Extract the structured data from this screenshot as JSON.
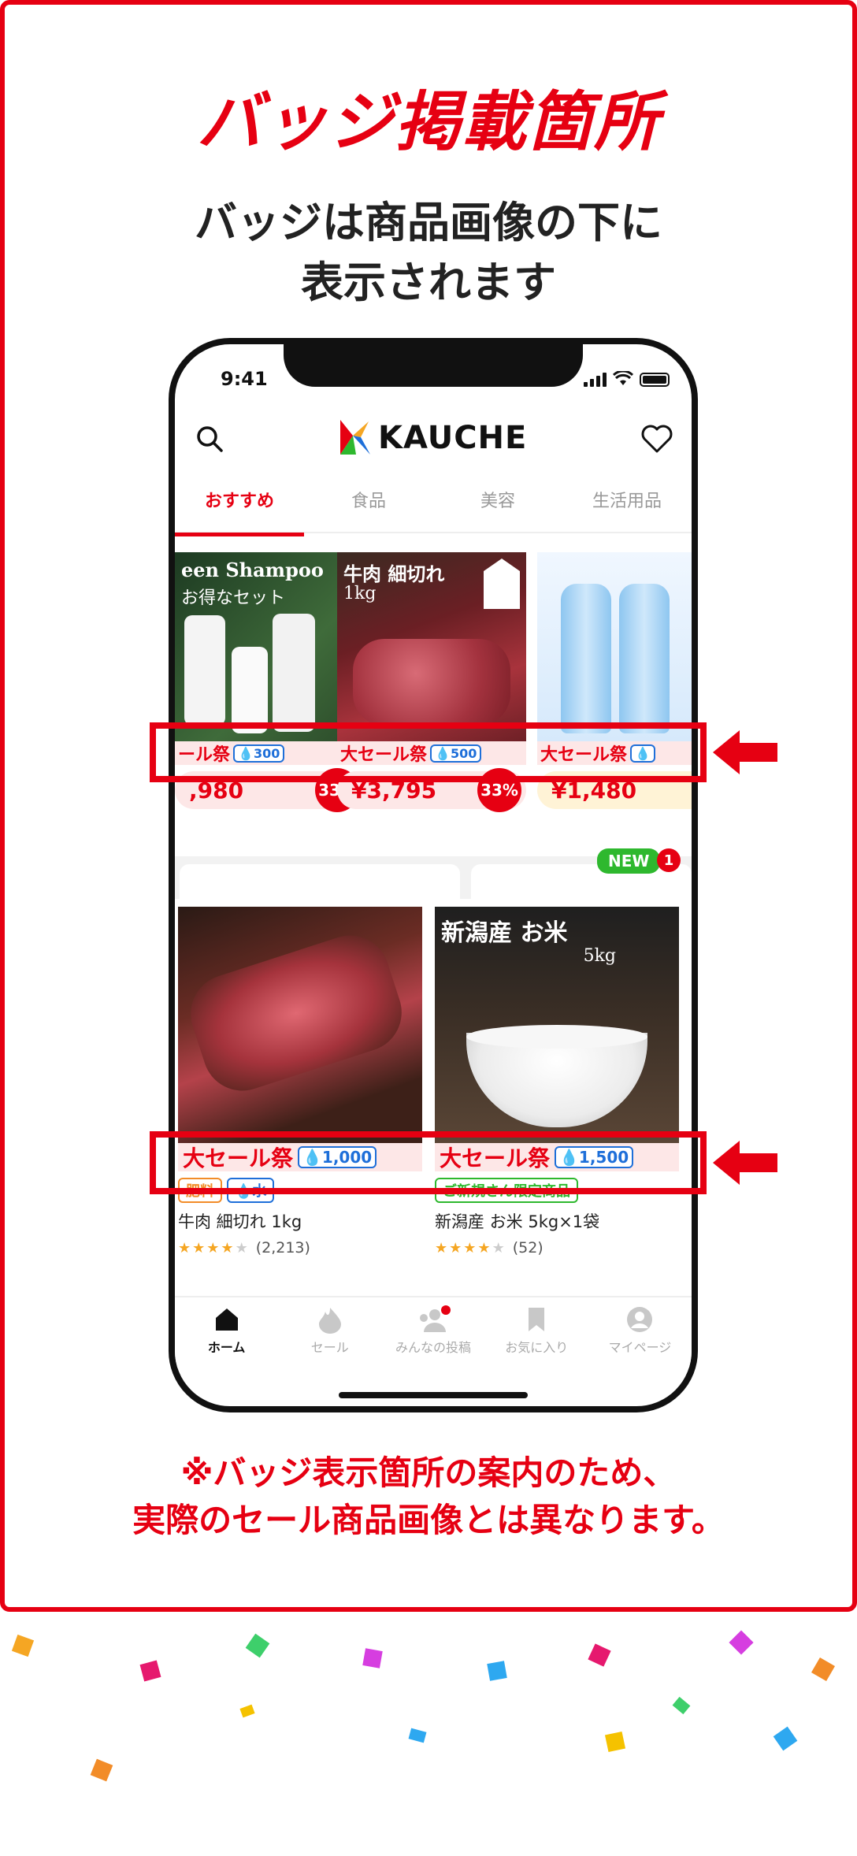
{
  "headline": "バッジ掲載箇所",
  "subhead": {
    "line1": "バッジは商品画像の下に",
    "line2": "表示されます"
  },
  "phone": {
    "status_time": "9:41",
    "logo_text": "KAUCHE",
    "tabs": [
      {
        "label": "おすすめ",
        "active": true
      },
      {
        "label": "食品",
        "active": false
      },
      {
        "label": "美容",
        "active": false
      },
      {
        "label": "生活用品",
        "active": false
      }
    ],
    "products": [
      {
        "image_title": "een Shampoo",
        "image_sub": "お得なセット",
        "sale": "ール祭",
        "points": "💧300",
        "price": ",980",
        "discount": "33%"
      },
      {
        "image_title": "牛肉 細切れ",
        "image_sub": "1kg",
        "sale": "大セール祭",
        "points": "💧500",
        "price": "¥3,795",
        "discount": "33%"
      },
      {
        "image_title": "",
        "image_sub": "",
        "sale": "大セール祭",
        "points": "💧",
        "price": "¥1,480",
        "discount": ""
      }
    ],
    "new_badge": "NEW",
    "count_badge": "1",
    "big_products": [
      {
        "image_title": "",
        "sale": "大セール祭",
        "points": "💧1,000",
        "tags": [
          {
            "label": "肥料",
            "color": "#f28c28"
          },
          {
            "label": "💧水",
            "color": "#1e6fd9"
          }
        ],
        "name": "牛肉 細切れ 1kg",
        "rating": 4,
        "reviews": "(2,213)"
      },
      {
        "image_title": "新潟産 お米",
        "image_sub": "5kg",
        "sale": "大セール祭",
        "points": "💧1,500",
        "tags": [
          {
            "label": "ご新規さん限定商品",
            "color": "#2eb82e"
          }
        ],
        "name": "新潟産 お米 5kg×1袋",
        "rating": 4,
        "reviews": "(52)"
      }
    ],
    "nav": [
      {
        "label": "ホーム",
        "icon": "home-icon",
        "active": true
      },
      {
        "label": "セール",
        "icon": "flame-icon",
        "active": false
      },
      {
        "label": "みんなの投稿",
        "icon": "people-icon",
        "active": false
      },
      {
        "label": "お気に入り",
        "icon": "bookmark-icon",
        "active": false
      },
      {
        "label": "マイページ",
        "icon": "user-icon",
        "active": false
      }
    ]
  },
  "notice": {
    "line1": "※バッジ表示箇所の案内のため、",
    "line2": "実際のセール商品画像とは異なります。"
  },
  "colors": {
    "accent": "#e60012",
    "points_blue": "#1e6fd9"
  }
}
